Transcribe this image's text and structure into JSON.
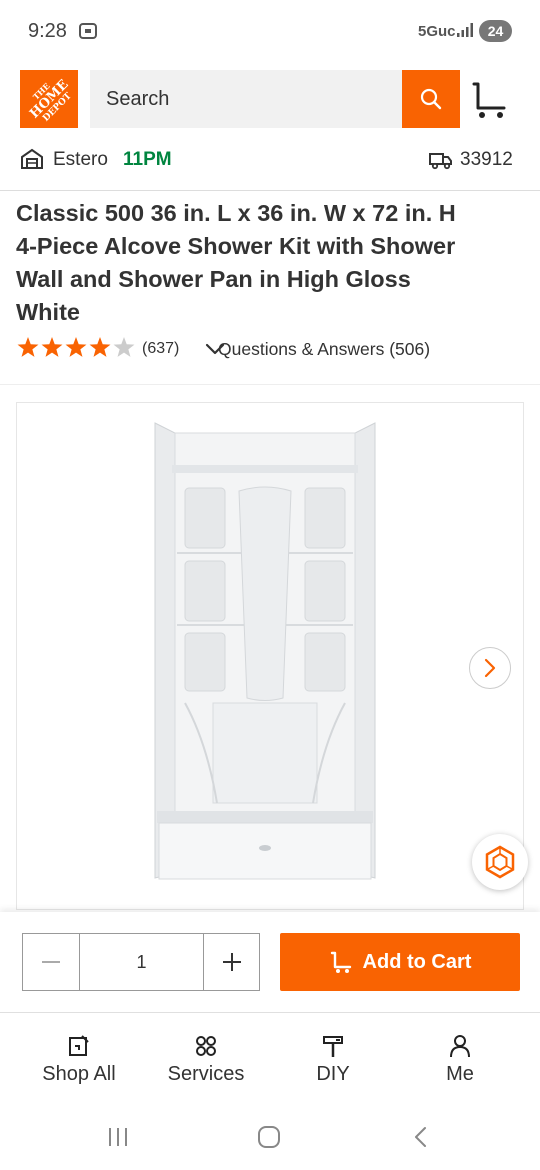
{
  "status_bar": {
    "time": "9:28",
    "network": "5Guc",
    "battery": "24"
  },
  "header": {
    "logo_text": "THE HOME DEPOT",
    "search_placeholder": "Search",
    "colors": {
      "brand": "#f96302",
      "search_bg": "#f1f1f1"
    }
  },
  "store": {
    "name": "Estero",
    "closing_time": "11PM",
    "zip": "33912"
  },
  "product": {
    "title": "Classic 500 36 in. L x 36 in. W x 72 in. H 4-Piece Alcove Shower Kit with Shower Wall and Shower Pan in High Gloss White",
    "rating": 4,
    "rating_max": 5,
    "review_count": "(637)",
    "qa_label": "Questions & Answers (506)"
  },
  "gallery": {
    "next_icon": "chevron-right-icon",
    "ar_icon": "hexagon-ar-icon"
  },
  "buybox": {
    "quantity": "1",
    "add_to_cart_label": "Add to Cart",
    "accent": "#f96302"
  },
  "tabs": [
    {
      "label": "Shop All",
      "icon": "shop-all-icon"
    },
    {
      "label": "Services",
      "icon": "services-icon"
    },
    {
      "label": "DIY",
      "icon": "diy-icon"
    },
    {
      "label": "Me",
      "icon": "person-icon"
    }
  ],
  "status_colors": {
    "open_time": "#00853f"
  }
}
